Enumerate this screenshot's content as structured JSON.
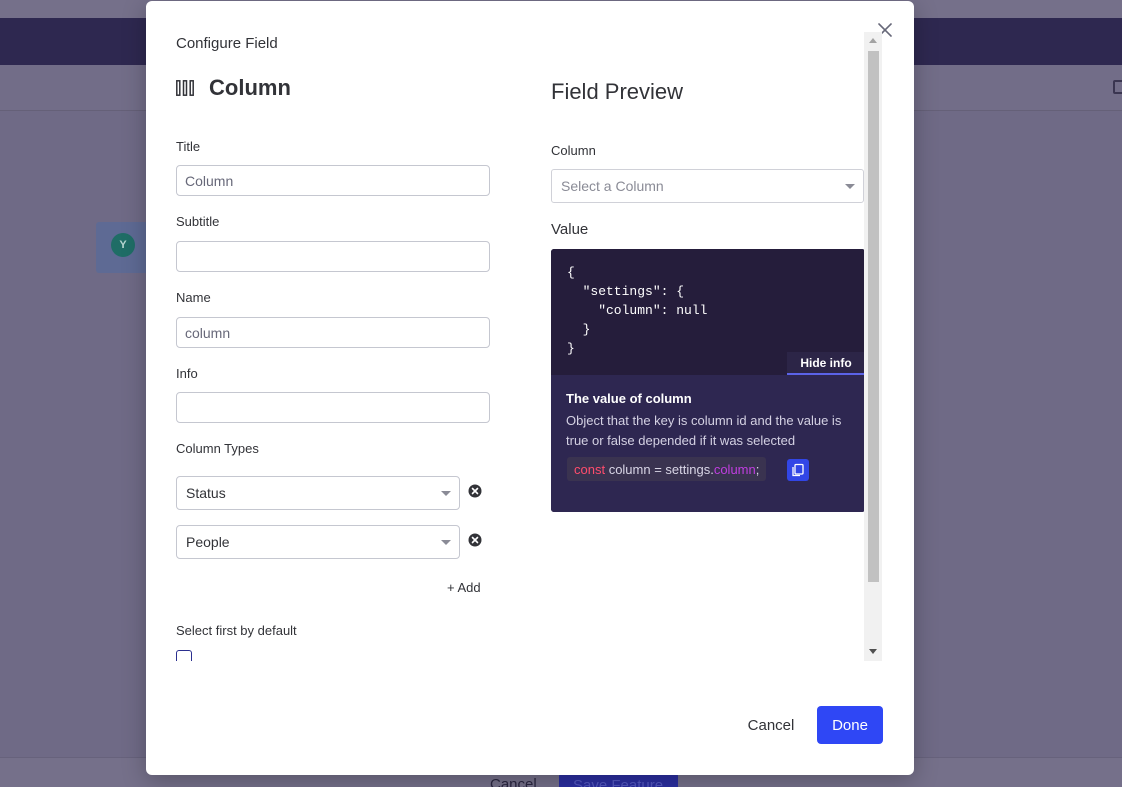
{
  "background": {
    "avatar_letter": "Y",
    "footer_cancel": "Cancel",
    "footer_save": "Save Feature"
  },
  "modal": {
    "title": "Configure Field",
    "close_icon": "close-icon"
  },
  "field": {
    "icon": "column-icon",
    "name": "Column"
  },
  "form": {
    "title_label": "Title",
    "title_value": "Column",
    "subtitle_label": "Subtitle",
    "subtitle_value": "",
    "name_label": "Name",
    "name_value": "column",
    "info_label": "Info",
    "info_value": "",
    "column_types_label": "Column Types",
    "column_types": [
      {
        "value": "Status"
      },
      {
        "value": "People"
      }
    ],
    "add_label": "+ Add",
    "select_first_label": "Select first by default",
    "select_first_checked": false
  },
  "preview": {
    "title": "Field Preview",
    "column_label": "Column",
    "column_placeholder": "Select a Column",
    "value_label": "Value",
    "code": "{\n  \"settings\": {\n    \"column\": null\n  }\n}",
    "hide_info_label": "Hide info",
    "info_title": "The value of column",
    "info_description": "Object that the key is column id and the value is true or false depended if it was selected",
    "snippet_keyword": "const",
    "snippet_middle": " column = settings.",
    "snippet_property": "column",
    "snippet_end": ";"
  },
  "actions": {
    "cancel_label": "Cancel",
    "done_label": "Done"
  },
  "colors": {
    "primary": "#2f47f5",
    "code_bg": "#251d3b",
    "overlay": "#6f6a86"
  }
}
